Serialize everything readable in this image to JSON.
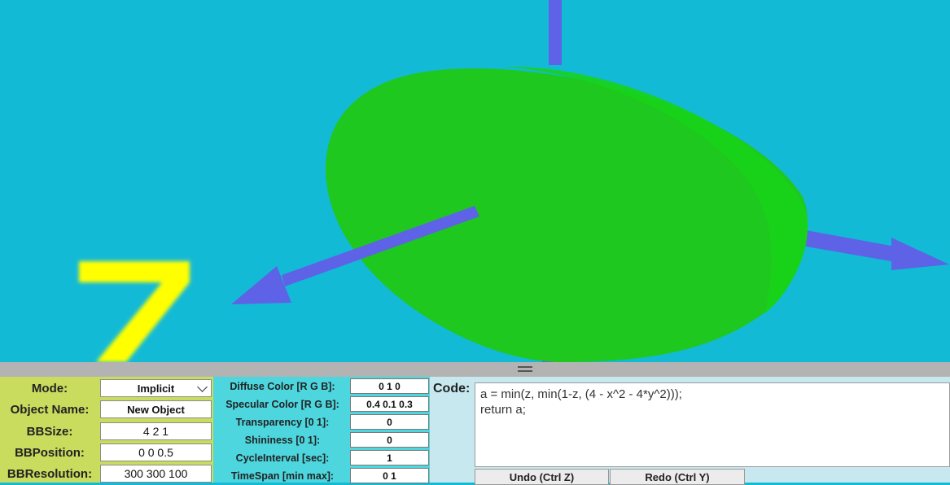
{
  "viewport": {
    "background_color": "#13bad6",
    "object_color": "#1ec81e",
    "axis_color": "#5e62e6",
    "axis_label_color": "#ffff00",
    "axis_label": "7"
  },
  "splitter": {
    "icon": "grip-lines-icon"
  },
  "properties": {
    "mode_label": "Mode:",
    "mode_value": "Implicit",
    "object_name_label": "Object Name:",
    "object_name_value": "New Object",
    "bbsize_label": "BBSize:",
    "bbsize_value": "4 2 1",
    "bbposition_label": "BBPosition:",
    "bbposition_value": "0 0 0.5",
    "bbresolution_label": "BBResolution:",
    "bbresolution_value": "300 300 100"
  },
  "material": {
    "diffuse_label": "Diffuse Color [R G B]:",
    "diffuse_value": "0 1 0",
    "specular_label": "Specular Color [R G B]:",
    "specular_value": "0.4 0.1 0.3",
    "transparency_label": "Transparency [0 1]:",
    "transparency_value": "0",
    "shininess_label": "Shininess [0 1]:",
    "shininess_value": "0",
    "cycle_label": "CycleInterval [sec]:",
    "cycle_value": "1",
    "timespan_label": "TimeSpan [min max]:",
    "timespan_value": "0 1"
  },
  "code": {
    "label": "Code:",
    "line1": "a = min(z, min(1-z, (4 - x^2 - 4*y^2)));",
    "line2": "return a;",
    "undo_label": "Undo (Ctrl Z)",
    "redo_label": "Redo (Ctrl Y)"
  }
}
